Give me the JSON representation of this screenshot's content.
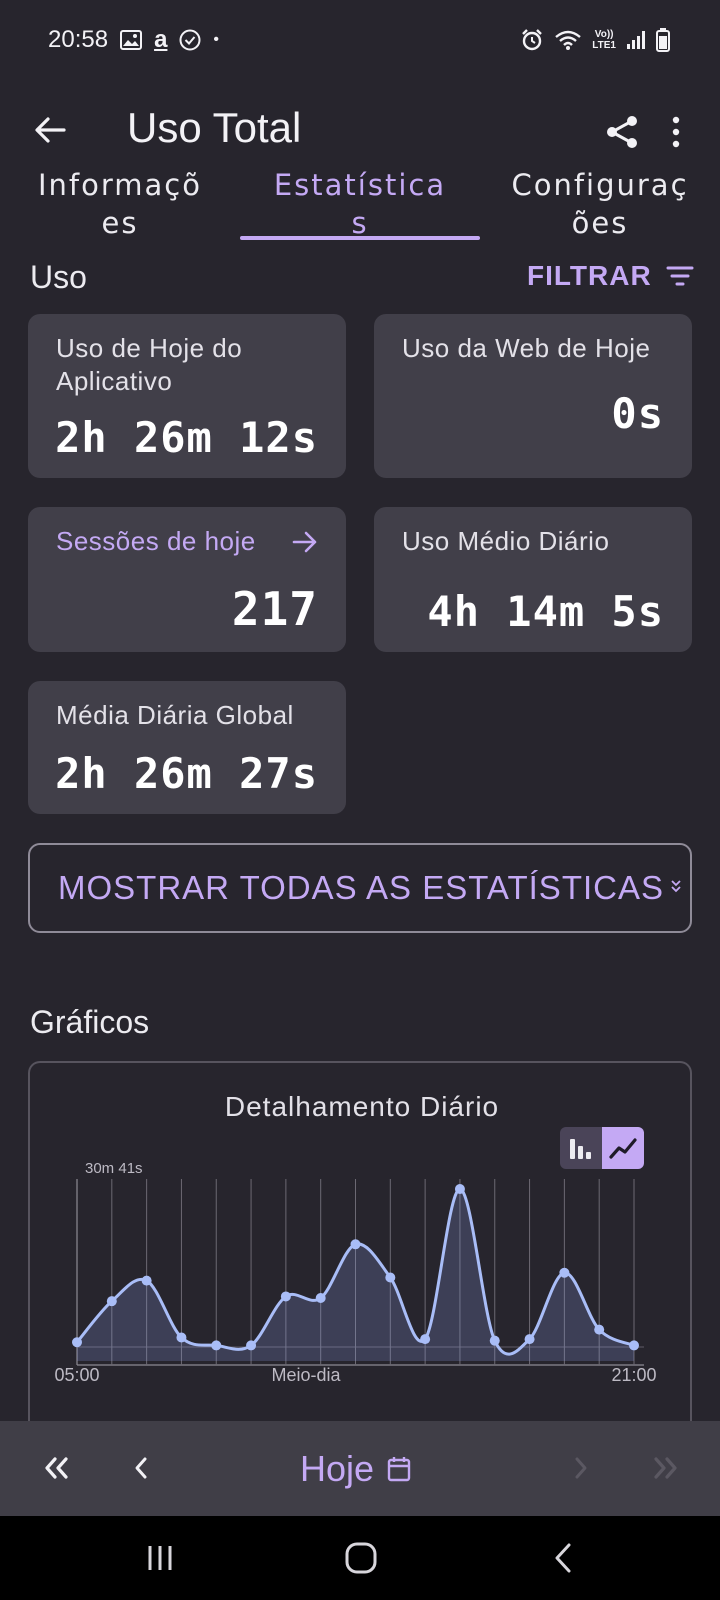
{
  "status_bar": {
    "time": "20:58",
    "amazon_glyph": "a",
    "dot": "•",
    "volte_top": "Vo))",
    "volte_bottom": "LTE1"
  },
  "app_bar": {
    "title": "Uso Total"
  },
  "tabs": [
    {
      "line1": "Informaçõ",
      "line2": "es",
      "active": false
    },
    {
      "line1": "Estatística",
      "line2": "s",
      "active": true
    },
    {
      "line1": "Configuraç",
      "line2": "ões",
      "active": false
    }
  ],
  "usage": {
    "title": "Uso",
    "filter_label": "FILTRAR"
  },
  "cards": {
    "app_today": {
      "label": "Uso de Hoje do Aplicativo",
      "value": "2h 26m 12s"
    },
    "web_today": {
      "label": "Uso da Web de Hoje",
      "value": "0s"
    },
    "sessions": {
      "label": "Sessões de hoje",
      "value": "217"
    },
    "avg_daily": {
      "label": "Uso Médio Diário",
      "value": "4h 14m 5s"
    },
    "global_avg": {
      "label": "Média Diária Global",
      "value": "2h 26m 27s"
    }
  },
  "show_all_label": "MOSTRAR TODAS AS ESTATÍSTICAS",
  "charts": {
    "title": "Gráficos",
    "chart_title": "Detalhamento Diário"
  },
  "chart_data": {
    "type": "area",
    "title": "Detalhamento Diário",
    "y_max_label": "30m 41s",
    "x_tick_labels": [
      "05:00",
      "Meio-dia",
      "21:00"
    ],
    "x": [
      "05:00",
      "06:00",
      "07:00",
      "08:00",
      "09:00",
      "10:00",
      "11:00",
      "12:00",
      "13:00",
      "14:00",
      "15:00",
      "16:00",
      "17:00",
      "18:00",
      "19:00",
      "20:00",
      "21:00"
    ],
    "values": [
      0.03,
      0.29,
      0.42,
      0.06,
      0.01,
      0.01,
      0.32,
      0.31,
      0.65,
      0.44,
      0.05,
      1.0,
      0.04,
      0.05,
      0.47,
      0.11,
      0.01
    ],
    "values_unit": "fraction of y max (30m 41s)",
    "accent": "#a9bdf7",
    "grid": true
  },
  "bottom_nav": {
    "today_label": "Hoje"
  },
  "colors": {
    "background": "#27252d",
    "card": "#413f49",
    "accent": "#c4a9f4"
  }
}
